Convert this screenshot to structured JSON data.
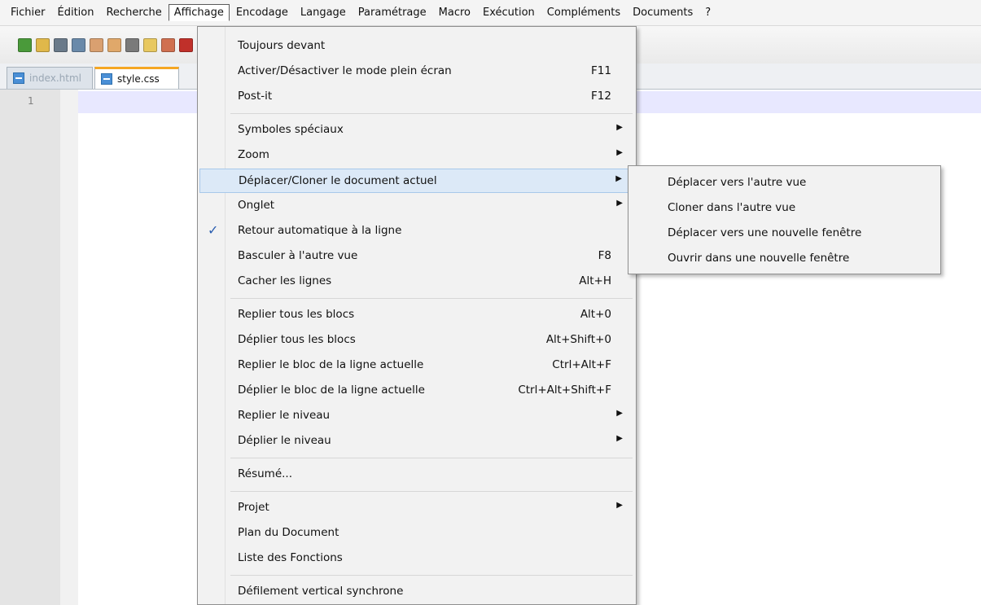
{
  "menubar": {
    "items": [
      "Fichier",
      "Édition",
      "Recherche",
      "Affichage",
      "Encodage",
      "Langage",
      "Paramétrage",
      "Macro",
      "Exécution",
      "Compléments",
      "Documents",
      "?"
    ],
    "active": "Affichage"
  },
  "toolbar": {
    "icons": [
      "new-file-icon",
      "open-folder-icon",
      "save-icon",
      "save-all-icon",
      "close-icon",
      "close-all-icon",
      "print-icon",
      "sync-scroll-icon",
      "panel-icon",
      "clipboard-icon",
      "record-macro-icon",
      "stop-macro-icon",
      "play-macro-icon",
      "run-macro-icon",
      "save-macro-icon",
      "spellcheck-icon",
      "spellcheck-options-icon",
      "spellcheck-check-icon"
    ],
    "colors": [
      "#4a9a3a",
      "#e0b84a",
      "#6a7a8a",
      "#6a8aaa",
      "#d9a070",
      "#e0a86a",
      "#7a7a7a",
      "#e8c860",
      "#d07050",
      "#c0302a",
      "#c02020",
      "#202020",
      "#3a78c8",
      "#3a78c8",
      "#3a78c8",
      "#2a5ab0",
      "#c8a24a",
      "#3a9ac8"
    ]
  },
  "tabs": [
    {
      "label": "index.html",
      "active": false
    },
    {
      "label": "style.css",
      "active": true
    }
  ],
  "editor": {
    "line_number": "1"
  },
  "menu": {
    "items": [
      {
        "label": "Toujours devant",
        "shortcut": "",
        "arrow": false,
        "checked": false,
        "highlighted": false
      },
      {
        "label": "Activer/Désactiver le mode plein écran",
        "shortcut": "F11",
        "arrow": false,
        "checked": false,
        "highlighted": false
      },
      {
        "label": "Post-it",
        "shortcut": "F12",
        "arrow": false,
        "checked": false,
        "highlighted": false
      },
      {
        "label": "Symboles spéciaux",
        "shortcut": "",
        "arrow": true,
        "checked": false,
        "highlighted": false
      },
      {
        "label": "Zoom",
        "shortcut": "",
        "arrow": true,
        "checked": false,
        "highlighted": false
      },
      {
        "label": "Déplacer/Cloner le document actuel",
        "shortcut": "",
        "arrow": true,
        "checked": false,
        "highlighted": true
      },
      {
        "label": "Onglet",
        "shortcut": "",
        "arrow": true,
        "checked": false,
        "highlighted": false
      },
      {
        "label": "Retour automatique à la ligne",
        "shortcut": "",
        "arrow": false,
        "checked": true,
        "highlighted": false
      },
      {
        "label": "Basculer à l'autre vue",
        "shortcut": "F8",
        "arrow": false,
        "checked": false,
        "highlighted": false
      },
      {
        "label": "Cacher les lignes",
        "shortcut": "Alt+H",
        "arrow": false,
        "checked": false,
        "highlighted": false
      },
      {
        "label": "Replier tous les blocs",
        "shortcut": "Alt+0",
        "arrow": false,
        "checked": false,
        "highlighted": false
      },
      {
        "label": "Déplier tous les blocs",
        "shortcut": "Alt+Shift+0",
        "arrow": false,
        "checked": false,
        "highlighted": false
      },
      {
        "label": "Replier le bloc de la ligne actuelle",
        "shortcut": "Ctrl+Alt+F",
        "arrow": false,
        "checked": false,
        "highlighted": false
      },
      {
        "label": "Déplier le bloc de la ligne actuelle",
        "shortcut": "Ctrl+Alt+Shift+F",
        "arrow": false,
        "checked": false,
        "highlighted": false
      },
      {
        "label": "Replier le niveau",
        "shortcut": "",
        "arrow": true,
        "checked": false,
        "highlighted": false
      },
      {
        "label": "Déplier le niveau",
        "shortcut": "",
        "arrow": true,
        "checked": false,
        "highlighted": false
      },
      {
        "label": "Résumé...",
        "shortcut": "",
        "arrow": false,
        "checked": false,
        "highlighted": false
      },
      {
        "label": "Projet",
        "shortcut": "",
        "arrow": true,
        "checked": false,
        "highlighted": false
      },
      {
        "label": "Plan du Document",
        "shortcut": "",
        "arrow": false,
        "checked": false,
        "highlighted": false
      },
      {
        "label": "Liste des Fonctions",
        "shortcut": "",
        "arrow": false,
        "checked": false,
        "highlighted": false
      },
      {
        "label": "Défilement vertical synchrone",
        "shortcut": "",
        "arrow": false,
        "checked": false,
        "highlighted": false
      }
    ],
    "separators_after": [
      2,
      9,
      15,
      16,
      19
    ]
  },
  "submenu": {
    "items": [
      "Déplacer vers l'autre vue",
      "Cloner dans l'autre vue",
      "Déplacer vers une nouvelle fenêtre",
      "Ouvrir dans une nouvelle fenêtre"
    ]
  }
}
